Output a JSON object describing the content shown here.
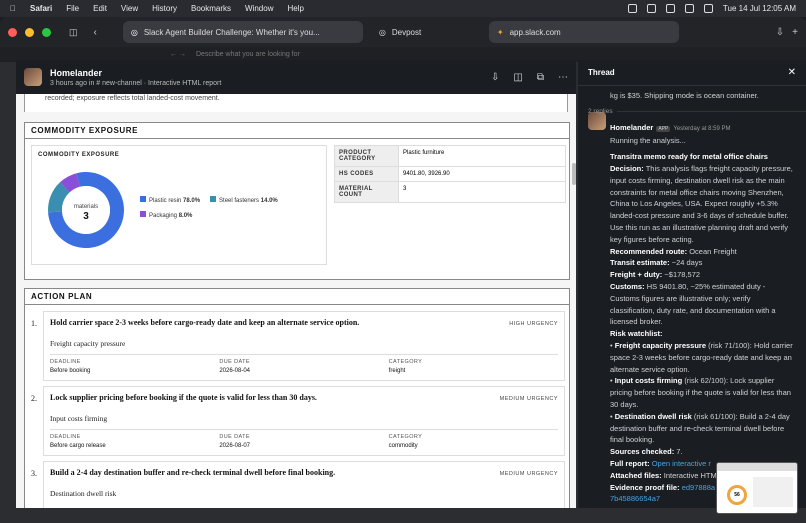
{
  "menubar": {
    "apple_icon": "apple-icon",
    "app_name": "Safari",
    "items": [
      "File",
      "Edit",
      "View",
      "History",
      "Bookmarks",
      "Window",
      "Help"
    ],
    "clock": "Tue 14 Jul  12:05 AM"
  },
  "browser": {
    "tabs": [
      {
        "label": "Slack Agent Builder Challenge: Whether it's you..."
      },
      {
        "label": "Devpost"
      },
      {
        "label": "app.slack.com"
      }
    ],
    "search_placeholder": "Describe what you are looking for"
  },
  "message_header": {
    "name": "Homelander",
    "meta": "3 hours ago in # new-channel  · Interactive HTML report"
  },
  "report": {
    "cut_text": "recorded; exposure reflects total landed-cost movement.",
    "commodity": {
      "heading": "COMMODITY EXPOSURE",
      "chart_label": "COMMODITY EXPOSURE",
      "center_label": "materials",
      "center_value": "3",
      "legend": [
        {
          "name": "Plastic resin",
          "value": "78.0%"
        },
        {
          "name": "Steel fasteners",
          "value": "14.0%"
        },
        {
          "name": "Packaging",
          "value": "8.0%"
        }
      ],
      "kv": [
        {
          "k": "PRODUCT CATEGORY",
          "v": "Plastic furniture"
        },
        {
          "k": "HS CODES",
          "v": "9401.80, 3926.90"
        },
        {
          "k": "MATERIAL COUNT",
          "v": "3"
        }
      ]
    },
    "action_plan": {
      "heading": "ACTION PLAN",
      "items": [
        {
          "num": "1.",
          "title": "Hold carrier space 2-3 weeks before cargo-ready date and keep an alternate service option.",
          "urgency": "HIGH URGENCY",
          "desc": "Freight capacity pressure",
          "deadline_k": "DEADLINE",
          "deadline": "Before booking",
          "due_k": "DUE DATE",
          "due": "2026-08-04",
          "cat_k": "CATEGORY",
          "cat": "freight"
        },
        {
          "num": "2.",
          "title": "Lock supplier pricing before booking if the quote is valid for less than 30 days.",
          "urgency": "MEDIUM URGENCY",
          "desc": "Input costs firming",
          "deadline_k": "DEADLINE",
          "deadline": "Before cargo release",
          "due_k": "DUE DATE",
          "due": "2026-08-07",
          "cat_k": "CATEGORY",
          "cat": "commodity"
        },
        {
          "num": "3.",
          "title": "Build a 2-4 day destination buffer and re-check terminal dwell before final booking.",
          "urgency": "MEDIUM URGENCY",
          "desc": "Destination dwell risk"
        }
      ]
    }
  },
  "chart_data": {
    "type": "pie",
    "categories": [
      "Plastic resin",
      "Steel fasteners",
      "Packaging"
    ],
    "values": [
      78.0,
      14.0,
      8.0
    ],
    "title": "COMMODITY EXPOSURE",
    "colors": [
      "#3b6fe0",
      "#3a8fb0",
      "#8a4fd8"
    ]
  },
  "thread": {
    "title": "Thread",
    "prev_text": "kg is $35. Shipping mode is ocean container.",
    "replies": "2 replies",
    "author": "Homelander",
    "app_badge": "APP",
    "time": "Yesterday at 8:59 PM",
    "running": "Running the analysis...",
    "memo_title": "Transitra memo ready for metal office chairs",
    "decision_label": "Decision:",
    "decision": "This analysis flags freight capacity pressure, input costs firming, destination dwell risk as the main constraints for metal office chairs moving Shenzhen, China to Los Angeles, USA. Expect roughly +5.3% landed-cost pressure and 3-6 days of schedule buffer. Use this run as an illustrative planning draft and verify key figures before acting.",
    "route_label": "Recommended route:",
    "route": "Ocean Freight",
    "transit_label": "Transit estimate:",
    "transit": "~24 days",
    "freight_label": "Freight + duty:",
    "freight": "~$178,572",
    "customs_label": "Customs:",
    "customs": "HS 9401.80, ~25% estimated duty - Customs figures are illustrative only; verify classification, duty rate, and documentation with a licensed broker.",
    "watch_label": "Risk watchlist:",
    "watch": [
      {
        "name": "Freight capacity pressure",
        "text": "(risk 71/100): Hold carrier space 2-3 weeks before cargo-ready date and keep an alternate service option."
      },
      {
        "name": "Input costs firming",
        "text": "(risk 62/100): Lock supplier pricing before booking if the quote is valid for less than 30 days."
      },
      {
        "name": "Destination dwell risk",
        "text": "(risk 61/100): Build a 2-4 day destination buffer and re-check terminal dwell before final booking."
      }
    ],
    "sources_label": "Sources checked:",
    "sources": "7.",
    "report_label": "Full report:",
    "report_link": "Open interactive r",
    "attached_label": "Attached files:",
    "attached": "Interactive HTM",
    "evidence_label": "Evidence proof file:",
    "evidence": "ed97888a",
    "evidence2": "7b45886654a7",
    "preview_value": "56"
  }
}
